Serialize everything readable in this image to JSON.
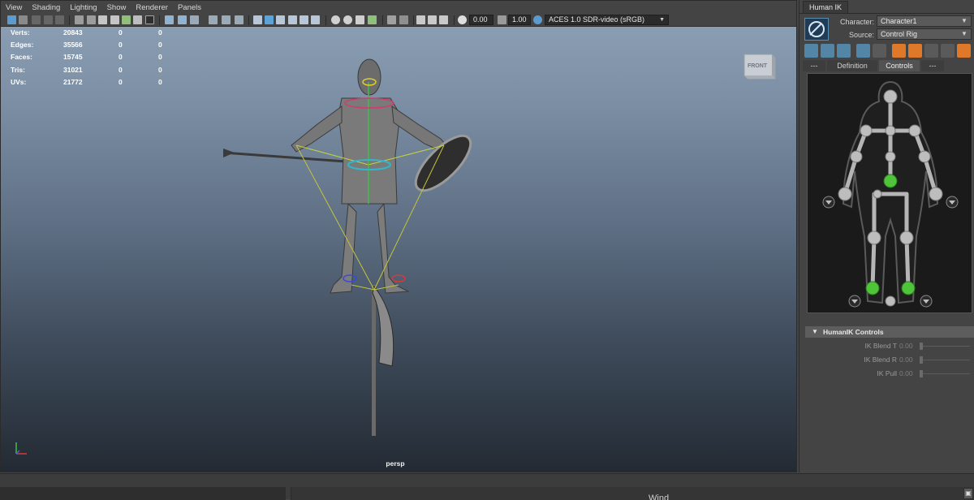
{
  "menu": [
    "View",
    "Shading",
    "Lighting",
    "Show",
    "Renderer",
    "Panels"
  ],
  "toolbar": {
    "exposure_value": "0.00",
    "gamma_value": "1.00",
    "color_space": "ACES 1.0 SDR-video (sRGB)"
  },
  "hud": {
    "rows": [
      {
        "label": "Verts:",
        "c1": "20843",
        "c2": "0",
        "c3": "0"
      },
      {
        "label": "Edges:",
        "c1": "35566",
        "c2": "0",
        "c3": "0"
      },
      {
        "label": "Faces:",
        "c1": "15745",
        "c2": "0",
        "c3": "0"
      },
      {
        "label": "Tris:",
        "c1": "31021",
        "c2": "0",
        "c3": "0"
      },
      {
        "label": "UVs:",
        "c1": "21772",
        "c2": "0",
        "c3": "0"
      }
    ]
  },
  "viewcube_label": "FRONT",
  "camera_label": "persp",
  "axis_labels": {
    "y": "y",
    "x": "x"
  },
  "humanik": {
    "tab_title": "Human IK",
    "character_label": "Character:",
    "character_value": "Character1",
    "source_label": "Source:",
    "source_value": "Control Rig",
    "tabs": [
      "---",
      "Definition",
      "Controls",
      "---"
    ],
    "active_tab": "Controls",
    "controls_header": "HumanIK Controls",
    "ik_rows": [
      {
        "label": "IK Blend T",
        "value": "0.00"
      },
      {
        "label": "IK Blend R",
        "value": "0.00"
      },
      {
        "label": "IK Pull",
        "value": "0.00"
      }
    ]
  },
  "bottom": {
    "partial_text": "Wind"
  },
  "colors": {
    "accent_blue": "#5285a6",
    "effector_green": "#4fc43b",
    "orange_icon": "#e0782a"
  }
}
